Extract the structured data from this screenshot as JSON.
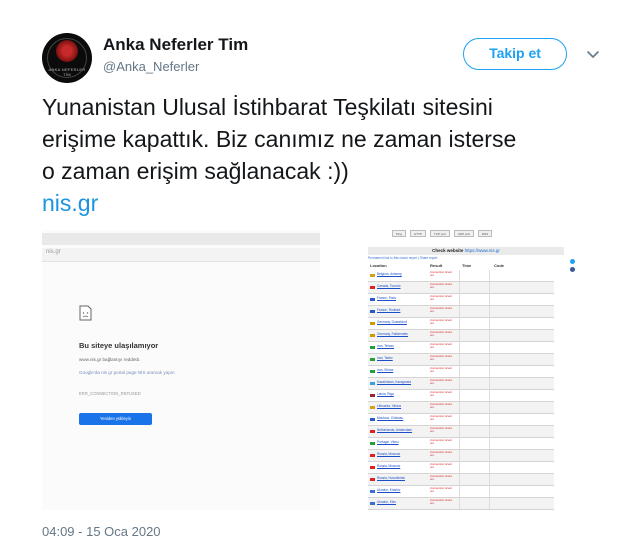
{
  "account": {
    "display_name": "Anka Neferler Tim",
    "handle": "@Anka_Neferler",
    "avatar_text": "ANKA NEFERLER TİM"
  },
  "follow_button": {
    "label": "Takip et"
  },
  "menu_icon": "chevron-down-icon",
  "tweet": {
    "lines": [
      "Yunanistan Ulusal İstihbarat Teşkilatı sitesini",
      "erişime kapattık. Biz canımız ne zaman isterse",
      "o zaman erişim sağlanacak :))"
    ],
    "link": "nis.gr"
  },
  "image_left": {
    "url": "nis.gr",
    "error_title": "Bu siteye ulaşılamıyor",
    "error_line1": "www.nis.gr bağlantıyı reddetti.",
    "error_line2": "Google'da nis gr portal page NIS aramak yapın",
    "error_code": "ERR_CONNECTION_REFUSED",
    "reload_button": "Yeniden yükleyin"
  },
  "image_right": {
    "tabs": [
      "Ping",
      "HTTP",
      "TCP port",
      "UDP port",
      "DNS"
    ],
    "check_title": "Check website",
    "check_url": "https://www.nis.gr",
    "sub_line": "Permanent link to this check report | Share report",
    "columns": [
      "Location",
      "Result",
      "Time",
      "Code"
    ],
    "result_text": "Connection timed out",
    "rows": [
      {
        "location": "Belgium, Antwerp",
        "flag": "#d4a017"
      },
      {
        "location": "Canada, Toronto",
        "flag": "#d22"
      },
      {
        "location": "France, Paris",
        "flag": "#2a57c9"
      },
      {
        "location": "France, Roubaix",
        "flag": "#2a57c9"
      },
      {
        "location": "Germany, Dusseldorf",
        "flag": "#cc9900"
      },
      {
        "location": "Germany, Falkenstein",
        "flag": "#cc9900"
      },
      {
        "location": "Iran, Tehran",
        "flag": "#2a9d3a"
      },
      {
        "location": "Iran, Tabriz",
        "flag": "#2a9d3a"
      },
      {
        "location": "Iran, Shiraz",
        "flag": "#2a9d3a"
      },
      {
        "location": "Kazakhstan, Karaganda",
        "flag": "#3aa0d8"
      },
      {
        "location": "Latvia, Riga",
        "flag": "#9b2335"
      },
      {
        "location": "Lithuania, Vilnius",
        "flag": "#d4a017"
      },
      {
        "location": "Moldova, Chisinau",
        "flag": "#2a57c9"
      },
      {
        "location": "Netherlands, Amsterdam",
        "flag": "#d22"
      },
      {
        "location": "Portugal, Viseu",
        "flag": "#2a9d3a"
      },
      {
        "location": "Russia, Moscow",
        "flag": "#d22"
      },
      {
        "location": "Russia, Moscow",
        "flag": "#d22"
      },
      {
        "location": "Russia, Novosibirsk",
        "flag": "#d22"
      },
      {
        "location": "Ukraine, Kharkiv",
        "flag": "#3a6fd0"
      },
      {
        "location": "Ukraine, Kiev",
        "flag": "#3a6fd0"
      },
      {
        "location": "Ukraine, Mykolaiv",
        "flag": "#3a6fd0"
      }
    ]
  },
  "timestamp": "04:09 - 15 Oca 2020",
  "colors": {
    "accent": "#1da1f2",
    "link": "#1b95e0",
    "text": "#14171a",
    "muted": "#657786"
  }
}
